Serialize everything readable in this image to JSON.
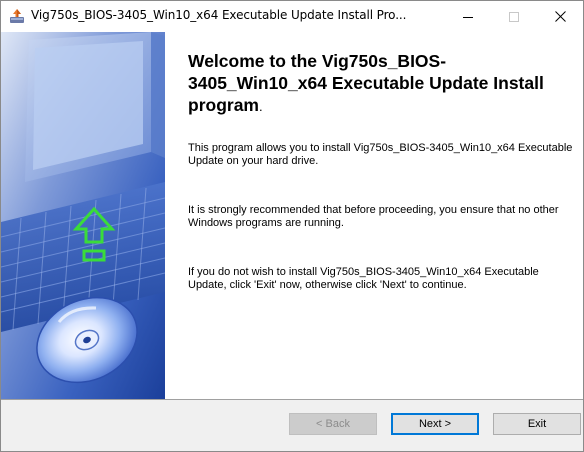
{
  "window": {
    "title": "Vig750s_BIOS-3405_Win10_x64 Executable Update Install Pro...",
    "controls": {
      "minimize_icon": "minimize-icon",
      "maximize_icon": "maximize-icon",
      "close_icon": "close-icon"
    }
  },
  "content": {
    "heading": "Welcome to the Vig750s_BIOS-3405_Win10_x64 Executable Update Install program",
    "heading_end": ".",
    "paragraphs": [
      "This program allows you to install Vig750s_BIOS-3405_Win10_x64 Executable Update on your hard drive.",
      "It is strongly recommended that before proceeding, you ensure that no other Windows programs are running.",
      "If you do not wish to install Vig750s_BIOS-3405_Win10_x64 Executable Update, click 'Exit' now, otherwise click 'Next' to continue."
    ]
  },
  "buttons": {
    "back": "< Back",
    "next": "Next >",
    "exit": "Exit"
  },
  "colors": {
    "accent": "#0078d7",
    "banner_blue": "#2f5bb8",
    "arrow_green": "#3adc3a"
  }
}
